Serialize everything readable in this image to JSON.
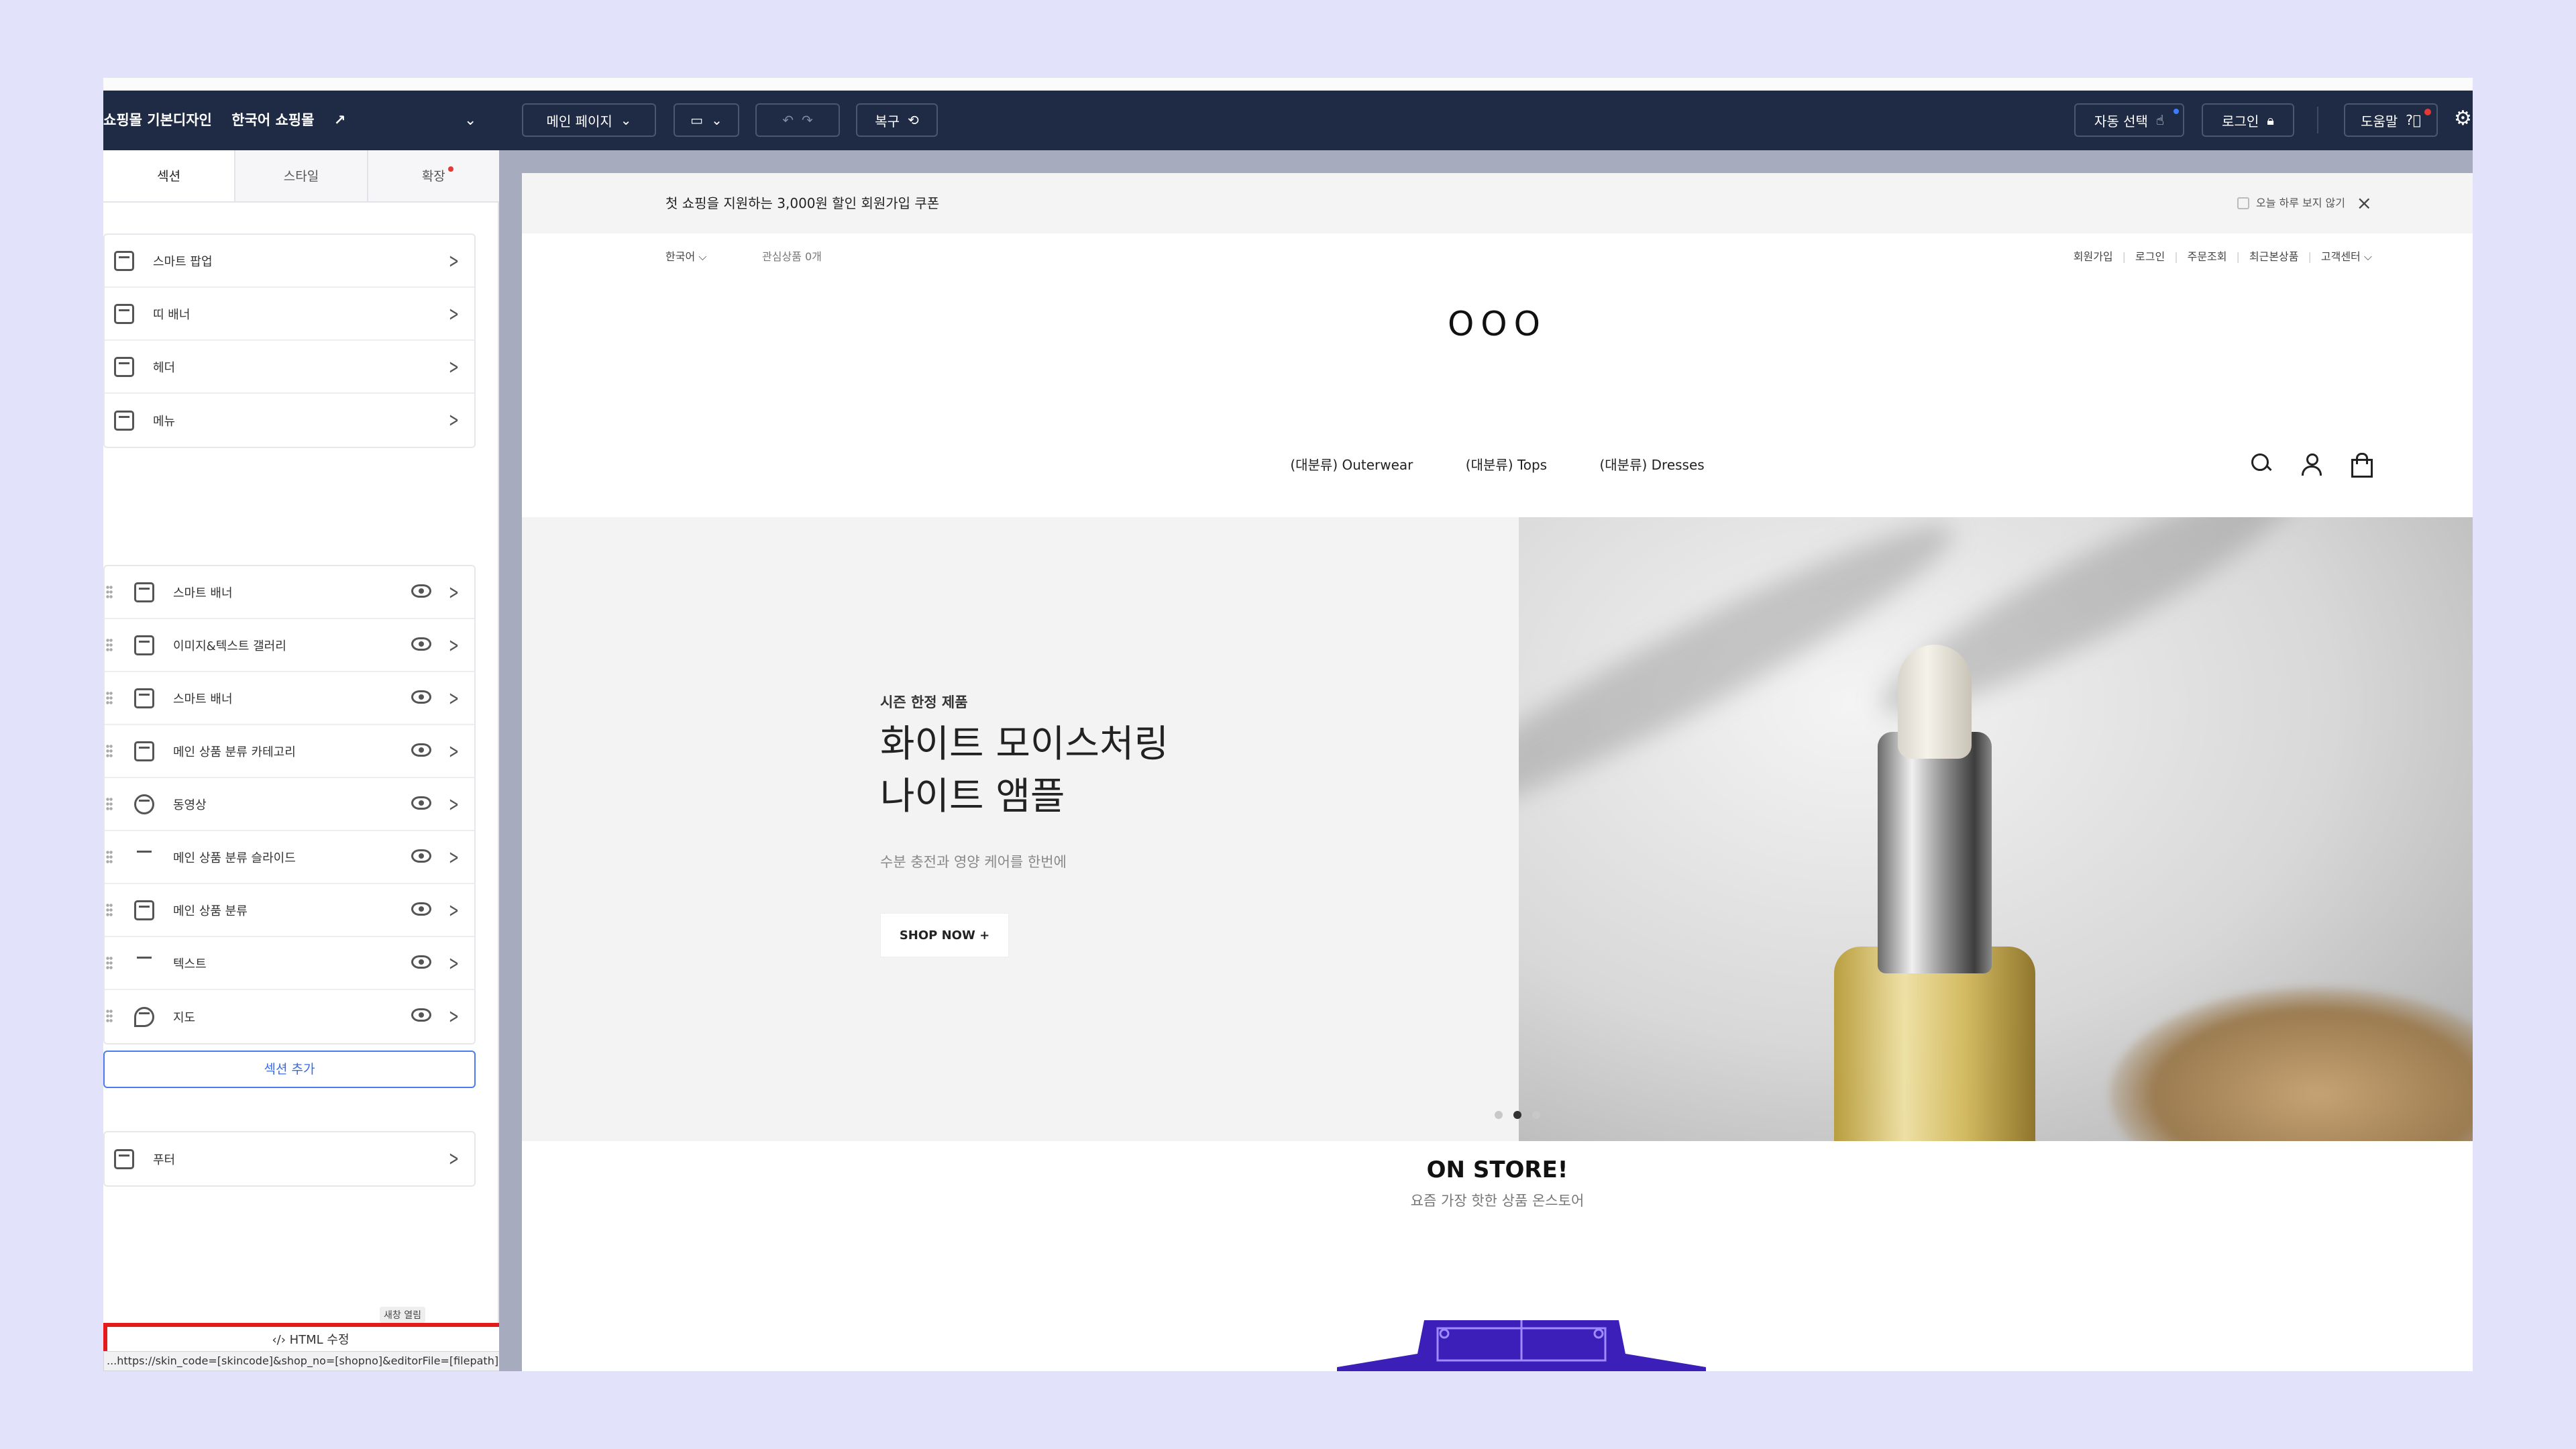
{
  "toolbar": {
    "site_name": "쇼핑몰 기본디자인",
    "shop_name": "한국어 쇼핑몰",
    "page_select": "메인 페이지",
    "restore_label": "복구",
    "auto_select_label": "자동 선택",
    "login_label": "로그인",
    "help_label": "도움말"
  },
  "sidebar": {
    "tabs": [
      {
        "label": "섹션"
      },
      {
        "label": "스타일"
      },
      {
        "label": "확장"
      }
    ],
    "fixed_items": [
      {
        "label": "스마트 팝업"
      },
      {
        "label": "띠 배너"
      },
      {
        "label": "헤더"
      },
      {
        "label": "메뉴"
      }
    ],
    "sections": [
      {
        "label": "스마트 배너"
      },
      {
        "label": "이미지&텍스트 갤러리"
      },
      {
        "label": "스마트 배너"
      },
      {
        "label": "메인 상품 분류 카테고리"
      },
      {
        "label": "동영상"
      },
      {
        "label": "메인 상품 분류 슬라이드"
      },
      {
        "label": "메인 상품 분류"
      },
      {
        "label": "텍스트"
      },
      {
        "label": "지도"
      }
    ],
    "add_section_label": "섹션 추가",
    "footer_label": "푸터",
    "help_tag": "새창 열림",
    "html_edit_label": "‹/› HTML 수정",
    "status_url": "...https://skin_code=[skincode]&shop_no=[shopno]&editorFile=[filepath]"
  },
  "preview": {
    "coupon_text": "첫 쇼핑을 지원하는 3,000원 할인 회원가입 쿠폰",
    "hide_today": "오늘 하루 보지 않기",
    "lang": "한국어 ⌵",
    "wishlist": "관심상품 0개",
    "util_links": [
      "회원가입",
      "로그인",
      "주문조회",
      "최근본상품",
      "고객센터 ⌵"
    ],
    "logo": "OOO",
    "menu": [
      "(대분류) Outerwear",
      "(대분류) Tops",
      "(대분류) Dresses"
    ],
    "hero": {
      "eyebrow": "시즌 한정 제품",
      "headline_1": "화이트 모이스처링",
      "headline_2": "나이트 앰플",
      "sub": "수분 충전과 영양 케어를 한번에",
      "cta": "SHOP NOW +"
    },
    "store_title": "ON STORE!",
    "store_sub": "요즘 가장 핫한 상품 온스토어"
  },
  "colors": {
    "toolbar_bg": "#1f2a44",
    "accent_blue": "#3a6be0",
    "highlight_red": "#e31b1b",
    "store_graphic": "#3b1fb8"
  }
}
